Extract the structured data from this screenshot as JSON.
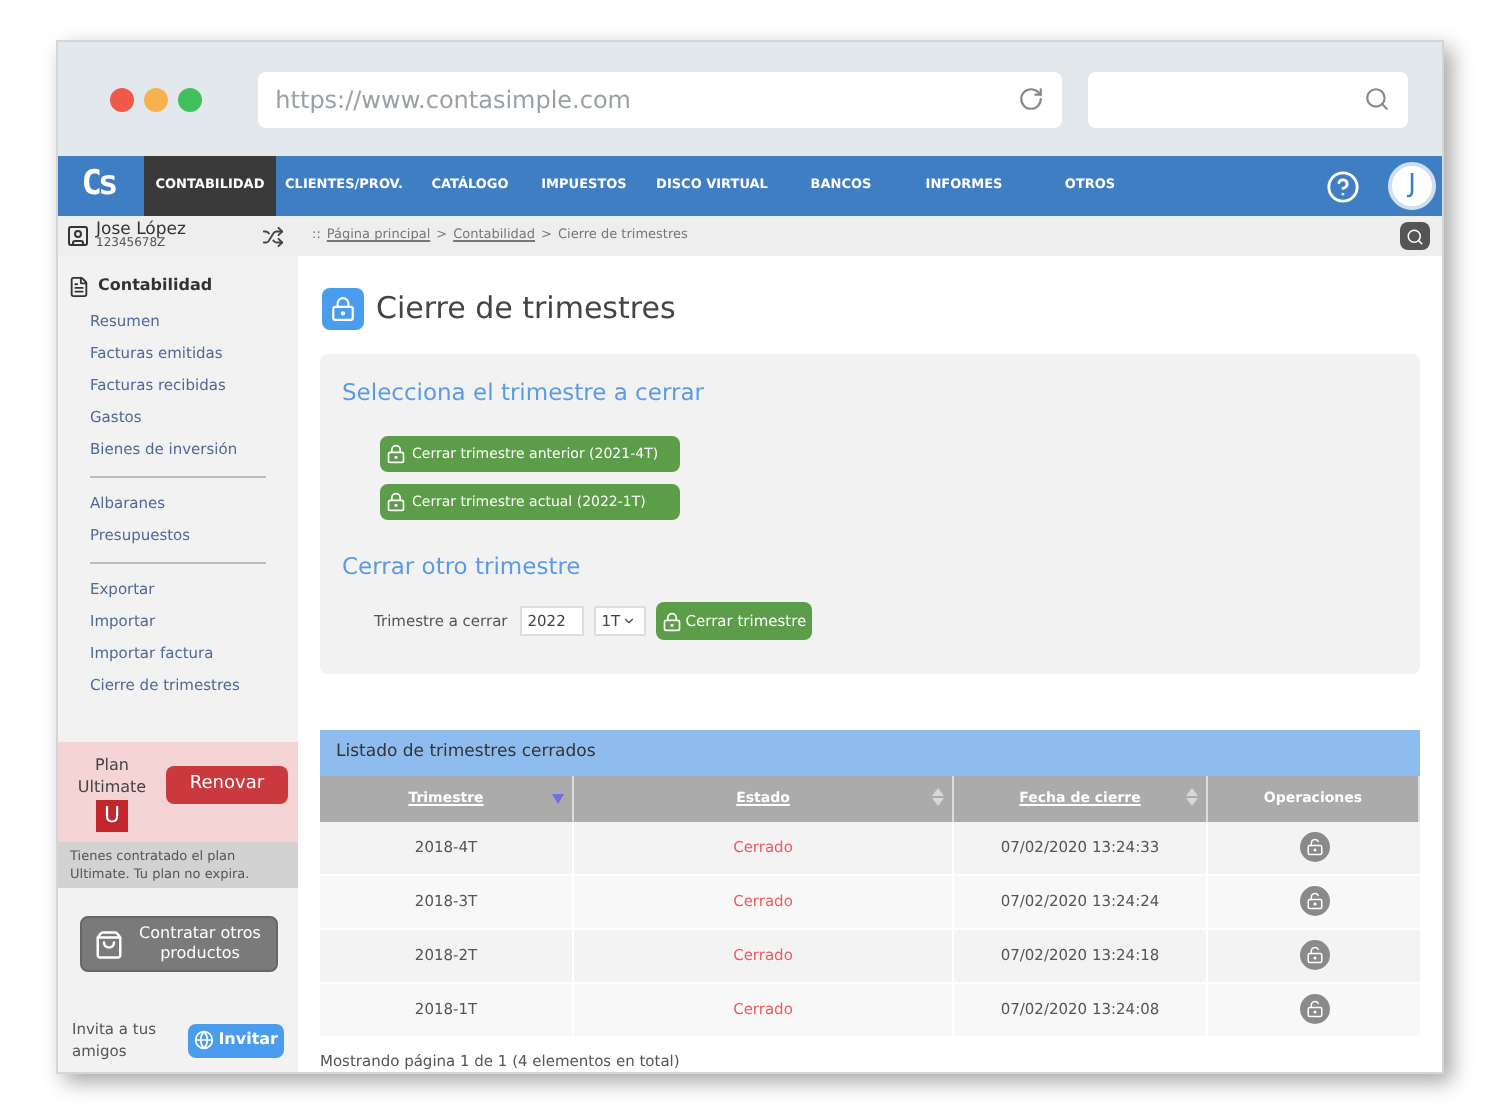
{
  "browser": {
    "url": "https://www.contasimple.com"
  },
  "logo": "Cs",
  "nav": [
    {
      "label": "CONTABILIDAD",
      "selected": true
    },
    {
      "label": "CLIENTES/PROV.",
      "selected": false
    },
    {
      "label": "CATÁLOGO",
      "selected": false
    },
    {
      "label": "IMPUESTOS",
      "selected": false
    },
    {
      "label": "DISCO VIRTUAL",
      "selected": false
    },
    {
      "label": "BANCOS",
      "selected": false
    },
    {
      "label": "INFORMES",
      "selected": false
    },
    {
      "label": "OTROS",
      "selected": false
    }
  ],
  "avatar": "J",
  "user": {
    "name": "Jose López",
    "id": "12345678Z"
  },
  "breadcrumb": {
    "prefix": "::",
    "separator": ">",
    "links": [
      "Página principal",
      "Contabilidad"
    ],
    "current": "Cierre de trimestres"
  },
  "sidebar": {
    "title": "Contabilidad",
    "groups": [
      [
        "Resumen",
        "Facturas emitidas",
        "Facturas recibidas",
        "Gastos",
        "Bienes de inversión"
      ],
      [
        "Albaranes",
        "Presupuestos"
      ],
      [
        "Exportar",
        "Importar",
        "Importar factura",
        "Cierre de trimestres"
      ]
    ]
  },
  "plan": {
    "label": "Plan",
    "name": "Ultimate",
    "letter": "U",
    "renew": "Renovar",
    "note": "Tienes contratado el plan Ultimate. Tu plan no expira."
  },
  "products_button": "Contratar otros productos",
  "invite": {
    "text": "Invita a tus amigos",
    "button": "Invitar"
  },
  "page_title": "Cierre de trimestres",
  "select_section": {
    "heading": "Selecciona el trimestre a cerrar",
    "buttons": [
      "Cerrar trimestre anterior (2021-4T)",
      "Cerrar trimestre actual (2022-1T)"
    ]
  },
  "other_section": {
    "heading": "Cerrar otro trimestre",
    "label": "Trimestre a cerrar",
    "year": "2022",
    "quarter": "1T",
    "button": "Cerrar trimestre"
  },
  "table": {
    "title": "Listado de trimestres cerrados",
    "columns": [
      {
        "label": "Trimestre",
        "sortable": true,
        "sorted": true
      },
      {
        "label": "Estado",
        "sortable": true,
        "sorted": false
      },
      {
        "label": "Fecha de cierre",
        "sortable": true,
        "sorted": false
      },
      {
        "label": "Operaciones",
        "sortable": false
      }
    ],
    "rows": [
      {
        "quarter": "2018-4T",
        "status": "Cerrado",
        "date": "07/02/2020 13:24:33"
      },
      {
        "quarter": "2018-3T",
        "status": "Cerrado",
        "date": "07/02/2020 13:24:24"
      },
      {
        "quarter": "2018-2T",
        "status": "Cerrado",
        "date": "07/02/2020 13:24:18"
      },
      {
        "quarter": "2018-1T",
        "status": "Cerrado",
        "date": "07/02/2020 13:24:08"
      }
    ],
    "footer": "Mostrando página 1 de 1 (4 elementos en total)"
  }
}
